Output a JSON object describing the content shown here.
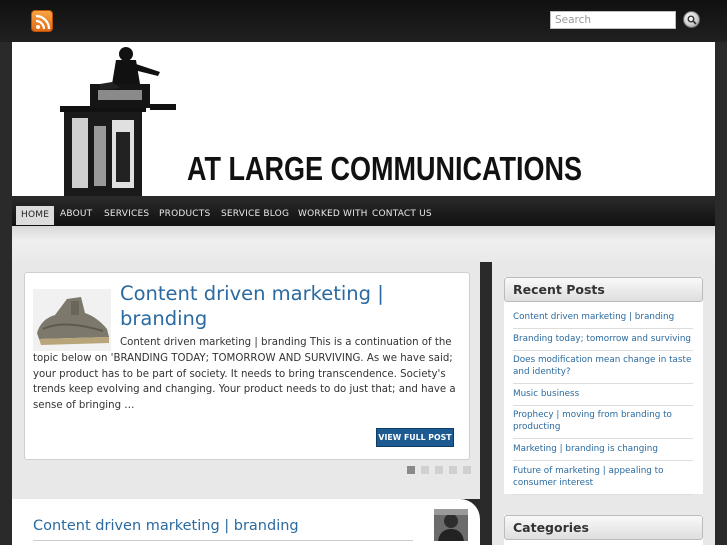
{
  "search": {
    "placeholder": "Search"
  },
  "header": {
    "site_name": "AT LARGE COMMUNICATIONS"
  },
  "nav": {
    "items": [
      {
        "label": "HOME"
      },
      {
        "label": "ABOUT"
      },
      {
        "label": "SERVICES"
      },
      {
        "label": "PRODUCTS"
      },
      {
        "label": "SERVICE BLOG"
      },
      {
        "label": "WORKED WITH"
      },
      {
        "label": "CONTACT US"
      }
    ]
  },
  "featured": {
    "title": "Content driven marketing | branding",
    "excerpt": "Content driven marketing | branding This is a continuation of the topic below on 'BRANDING TODAY; TOMORROW AND SURVIVING. As we have said; your product has to be part of society. It needs to bring transcendence. Society's trends keep evolving and changing. Your product needs to do just that; and have a sense of bringing …",
    "button": "VIEW FULL POST",
    "slide_count": 5,
    "active_slide": 1
  },
  "post": {
    "title": "Content driven marketing | branding"
  },
  "sidebar": {
    "recent_title": "Recent Posts",
    "recent_posts": [
      "Content driven marketing | branding",
      "Branding today; tomorrow and surviving",
      "Does modification mean change in taste and identity?",
      "Music business",
      "Prophecy | moving from branding to producting",
      "Marketing | branding is changing",
      "Future of marketing | appealing to consumer interest"
    ],
    "categories_title": "Categories"
  },
  "colors": {
    "link": "#2a6aa0",
    "button": "#1d5a91",
    "rss": "#f28b25"
  },
  "icons": {
    "rss": "rss-icon",
    "search": "search-icon"
  }
}
